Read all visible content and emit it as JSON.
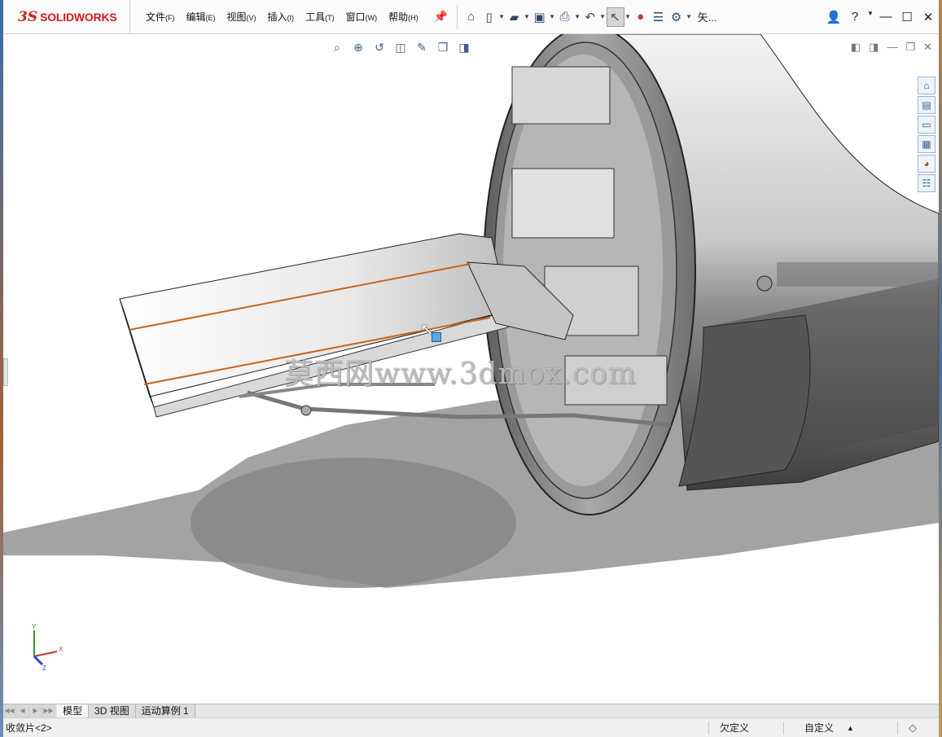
{
  "app": {
    "brand_symbol": "3S",
    "brand_name": "SOLIDWORKS",
    "title_fragment": "矢..."
  },
  "menu": [
    {
      "label": "文件",
      "key": "(F)"
    },
    {
      "label": "编辑",
      "key": "(E)"
    },
    {
      "label": "视图",
      "key": "(V)"
    },
    {
      "label": "插入",
      "key": "(I)"
    },
    {
      "label": "工具",
      "key": "(T)"
    },
    {
      "label": "窗口",
      "key": "(W)"
    },
    {
      "label": "帮助",
      "key": "(H)"
    }
  ],
  "toolbar_icons": [
    "home-icon",
    "new-document-icon",
    "open-icon",
    "save-icon",
    "print-icon",
    "undo-icon",
    "select-pointer-icon",
    "rebuild-traffic-light-icon",
    "file-properties-icon",
    "options-gear-icon"
  ],
  "viewport": {
    "watermark": "莫西网www.3dmox.com",
    "triad": {
      "x": "X",
      "y": "Y",
      "z": "Z"
    }
  },
  "tabs": {
    "model": "模型",
    "view3d": "3D 视图",
    "motion": "运动算例 1"
  },
  "status": {
    "left": "收敛片<2>",
    "definition": "欠定义",
    "units": "自定义",
    "units_caret": "▲"
  },
  "colors": {
    "brand_red": "#d51a1a",
    "edge_orange": "#c8641e",
    "selection_blue": "#5aa6e0"
  }
}
